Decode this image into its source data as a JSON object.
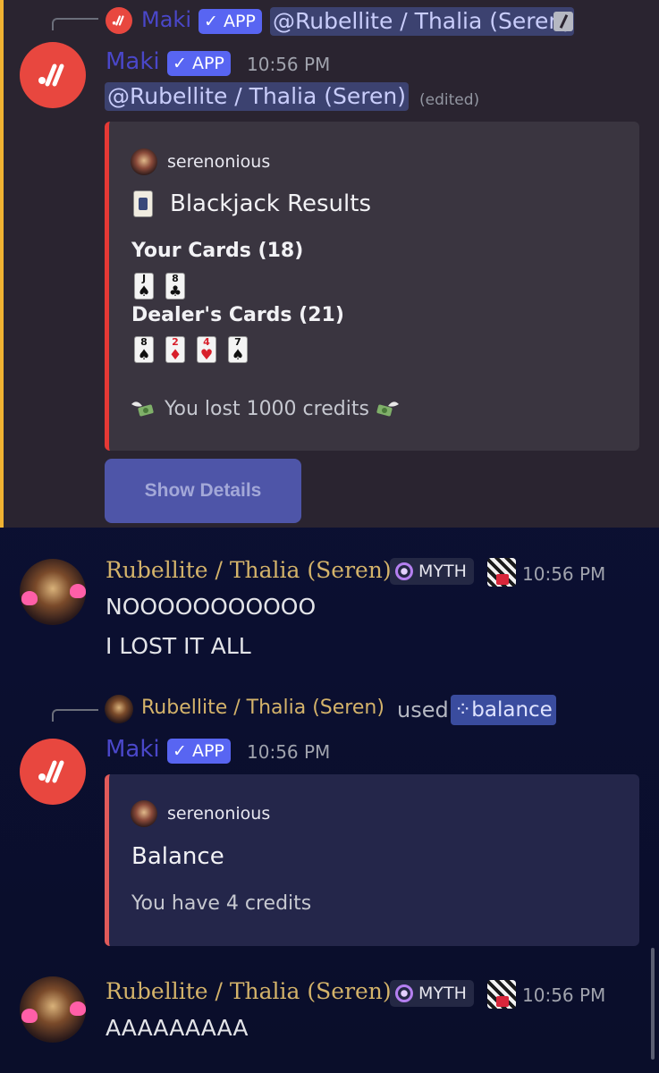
{
  "message1": {
    "reply": {
      "author": "Maki",
      "badge": "APP",
      "mention": "@Rubellite / Thalia (Seren)"
    },
    "author": "Maki",
    "badge": "APP",
    "time": "10:56 PM",
    "mention": "@Rubellite / Thalia (Seren)",
    "edited": "(edited)",
    "embed": {
      "author": "serenonious",
      "title": "Blackjack Results",
      "your_cards_label": "Your Cards (18)",
      "your_cards": [
        {
          "rank": "J",
          "suit": "♠",
          "color": "black"
        },
        {
          "rank": "8",
          "suit": "♣",
          "color": "black"
        }
      ],
      "dealer_cards_label": "Dealer's Cards (21)",
      "dealer_cards": [
        {
          "rank": "8",
          "suit": "♠",
          "color": "black"
        },
        {
          "rank": "2",
          "suit": "♦",
          "color": "red"
        },
        {
          "rank": "4",
          "suit": "♥",
          "color": "red"
        },
        {
          "rank": "7",
          "suit": "♠",
          "color": "black"
        }
      ],
      "result": "You lost 1000 credits"
    },
    "button_label": "Show Details"
  },
  "message2": {
    "author": "Rubellite / Thalia (Seren)",
    "role": "MYTH",
    "time": "10:56 PM",
    "lines": [
      "NOOOOOOOOOOO",
      "I LOST IT ALL"
    ]
  },
  "message3": {
    "reply": {
      "user": "Rubellite / Thalia (Seren)",
      "used": "used",
      "command": "balance"
    },
    "author": "Maki",
    "badge": "APP",
    "time": "10:56 PM",
    "embed": {
      "author": "serenonious",
      "title": "Balance",
      "description": "You have 4 credits"
    }
  },
  "message4": {
    "author": "Rubellite / Thalia (Seren)",
    "role": "MYTH",
    "time": "10:56 PM",
    "text": "AAAAAAAAA"
  },
  "colors": {
    "accent": "#5865f2",
    "mention_bar": "#f0b232",
    "embed_red": "#e53935",
    "username_gold": "#d4b36a",
    "maki_red": "#e8473f"
  }
}
